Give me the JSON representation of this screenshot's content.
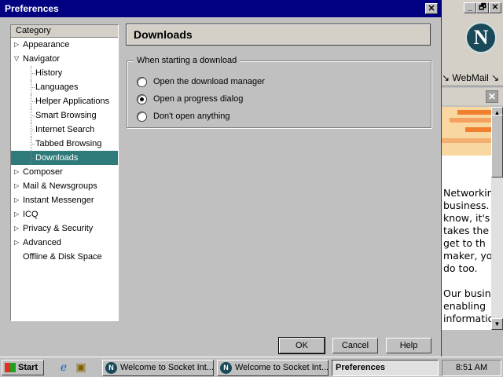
{
  "dialog": {
    "title": "Preferences",
    "close_label": "✕",
    "category_header": "Category",
    "tree": [
      {
        "label": "Appearance",
        "twisty": "▷",
        "level": 0
      },
      {
        "label": "Navigator",
        "twisty": "▽",
        "level": 0
      },
      {
        "label": "History",
        "level": 1
      },
      {
        "label": "Languages",
        "level": 1
      },
      {
        "label": "Helper Applications",
        "level": 1
      },
      {
        "label": "Smart Browsing",
        "level": 1
      },
      {
        "label": "Internet Search",
        "level": 1
      },
      {
        "label": "Tabbed Browsing",
        "level": 1
      },
      {
        "label": "Downloads",
        "level": 1,
        "selected": true
      },
      {
        "label": "Composer",
        "twisty": "▷",
        "level": 0
      },
      {
        "label": "Mail & Newsgroups",
        "twisty": "▷",
        "level": 0
      },
      {
        "label": "Instant Messenger",
        "twisty": "▷",
        "level": 0
      },
      {
        "label": "ICQ",
        "twisty": "▷",
        "level": 0
      },
      {
        "label": "Privacy & Security",
        "twisty": "▷",
        "level": 0
      },
      {
        "label": "Advanced",
        "twisty": "▷",
        "level": 0
      },
      {
        "label": "Offline & Disk Space",
        "level": 0
      }
    ],
    "panel_title": "Downloads",
    "group_label": "When starting a download",
    "options": [
      {
        "label": "Open the download manager",
        "selected": false
      },
      {
        "label": "Open a progress dialog",
        "selected": true
      },
      {
        "label": "Don't open anything",
        "selected": false
      }
    ],
    "buttons": {
      "ok": "OK",
      "cancel": "Cancel",
      "help": "Help"
    }
  },
  "background_window": {
    "controls": [
      "_",
      "🗗",
      "✕"
    ],
    "webmail": "↘ WebMail ↘",
    "logo": "N",
    "close_bar": "✕",
    "text_lines": [
      "Networkin",
      "business.",
      "know, it's",
      "takes the",
      "get to th",
      "maker, yo",
      "do too.",
      "",
      "Our busin",
      "enabling ",
      "informatio"
    ]
  },
  "taskbar": {
    "start": "Start",
    "tasks": [
      {
        "label": "Welcome to Socket Int...",
        "active": false
      },
      {
        "label": "Welcome to Socket Int...",
        "active": false
      },
      {
        "label": "Preferences",
        "active": true
      }
    ],
    "clock": "8:51 AM"
  },
  "colors": {
    "titlebar": "#000080",
    "selection": "#2f7a7a",
    "face": "#c0c0c0"
  }
}
